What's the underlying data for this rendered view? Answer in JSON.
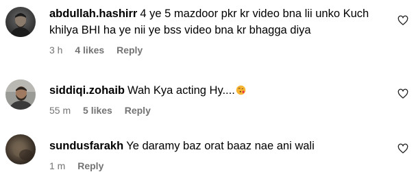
{
  "comments": [
    {
      "username": "abdullah.hashirr",
      "text": "4 ye 5 mazdoor pkr kr video bna lii unko Kuch khilya BHI ha ye nii ye bss video bna kr bhagga diya",
      "time": "3 h",
      "likes": "4 likes",
      "reply": "Reply",
      "avatar_icon": "avatar-dark-man"
    },
    {
      "username": "siddiqi.zohaib",
      "text": "Wah Kya acting Hy....",
      "emoji": "blowing-kiss-emoji",
      "time": "55 m",
      "likes": "5 likes",
      "reply": "Reply",
      "avatar_icon": "avatar-bearded-man"
    },
    {
      "username": "sundusfarakh",
      "text": "Ye daramy baz orat baaz nae ani wali",
      "time": "1 m",
      "reply": "Reply",
      "avatar_icon": "avatar-blurred-photo"
    }
  ],
  "like_icon": "heart-outline-icon",
  "colors": {
    "text": "#000000",
    "meta": "#737373",
    "background": "#ffffff"
  }
}
